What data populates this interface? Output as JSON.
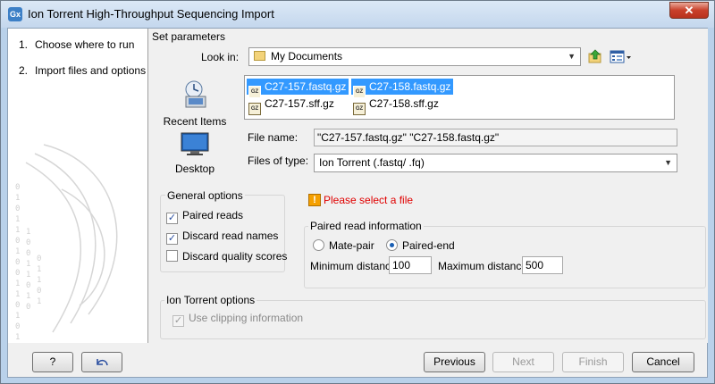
{
  "window": {
    "title": "Ion Torrent High-Throughput Sequencing Import",
    "icon_label": "Gx",
    "close_glyph": "✕"
  },
  "steps": [
    {
      "num": "1.",
      "label": "Choose where to run"
    },
    {
      "num": "2.",
      "label": "Import files and options"
    }
  ],
  "set_parameters": {
    "title": "Set parameters",
    "look_in_label": "Look in:",
    "look_in_value": "My Documents",
    "places": [
      "Recent Items",
      "Desktop"
    ],
    "files": [
      {
        "name": "C27-157.fastq.gz",
        "selected": true
      },
      {
        "name": "C27-158.fastq.gz",
        "selected": true
      },
      {
        "name": "C27-157.sff.gz",
        "selected": false
      },
      {
        "name": "C27-158.sff.gz",
        "selected": false
      }
    ],
    "file_icon_text": "GZ",
    "file_name_label": "File name:",
    "file_name_value": "\"C27-157.fastq.gz\" \"C27-158.fastq.gz\"",
    "files_of_type_label": "Files of type:",
    "files_of_type_value": "Ion Torrent (.fastq/ .fq)"
  },
  "general_options": {
    "title": "General options",
    "items": [
      {
        "label": "Paired reads",
        "checked": true
      },
      {
        "label": "Discard read names",
        "checked": true
      },
      {
        "label": "Discard quality scores",
        "checked": false
      }
    ]
  },
  "warning": {
    "text": "Please select a file",
    "icon_text": "!"
  },
  "paired_read": {
    "title": "Paired read information",
    "mate_pair_label": "Mate-pair",
    "paired_end_label": "Paired-end",
    "selected": "Paired-end",
    "min_label": "Minimum distance",
    "min_value": "100",
    "max_label": "Maximum distance",
    "max_value": "500"
  },
  "ion_torrent_options": {
    "title": "Ion Torrent options",
    "clipping_label": "Use clipping information",
    "clipping_checked": true,
    "enabled": false
  },
  "buttons": {
    "help": "?",
    "previous": "Previous",
    "next": "Next",
    "finish": "Finish",
    "cancel": "Cancel"
  },
  "check_glyph": "✓",
  "colors": {
    "selection": "#3399ff",
    "warning_text": "#e00000",
    "warning_icon": "#f5a000"
  }
}
